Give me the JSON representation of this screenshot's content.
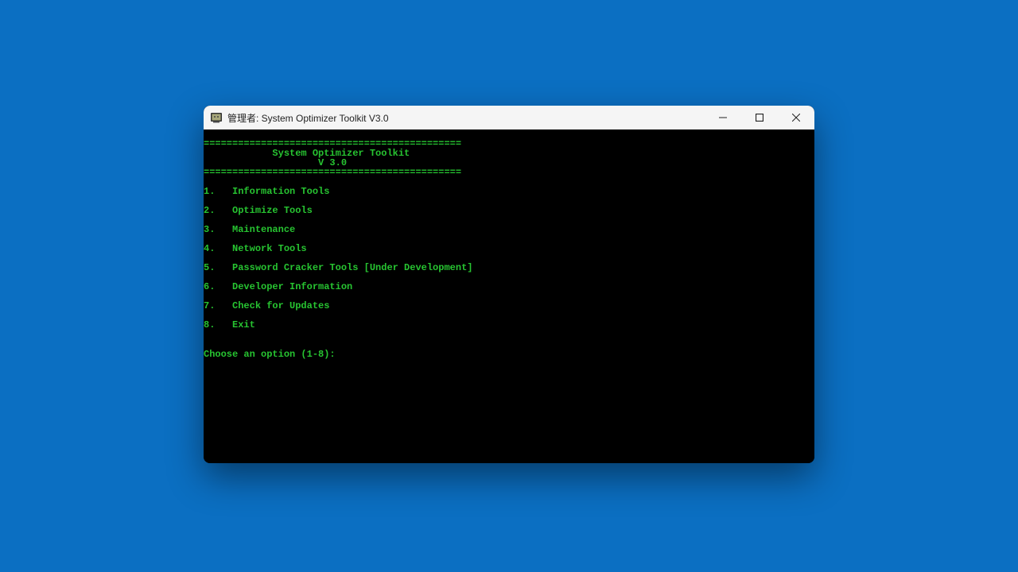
{
  "window": {
    "title": "管理者:  System Optimizer Toolkit V3.0"
  },
  "banner": {
    "divider": "=============================================",
    "line1": "            System Optimizer Toolkit",
    "line2": "                    V 3.0"
  },
  "menu": [
    {
      "idx": "1",
      "label": "Information Tools"
    },
    {
      "idx": "2",
      "label": "Optimize Tools"
    },
    {
      "idx": "3",
      "label": "Maintenance"
    },
    {
      "idx": "4",
      "label": "Network Tools"
    },
    {
      "idx": "5",
      "label": "Password Cracker Tools [Under Development]"
    },
    {
      "idx": "6",
      "label": "Developer Information"
    },
    {
      "idx": "7",
      "label": "Check for Updates"
    },
    {
      "idx": "8",
      "label": "Exit"
    }
  ],
  "menu_separator": ".   ",
  "prompt": "Choose an option (1-8):",
  "colors": {
    "desktop": "#0b6fc2",
    "terminal_fg": "#27c431",
    "terminal_bg": "#000000",
    "titlebar_bg": "#f5f5f5"
  }
}
